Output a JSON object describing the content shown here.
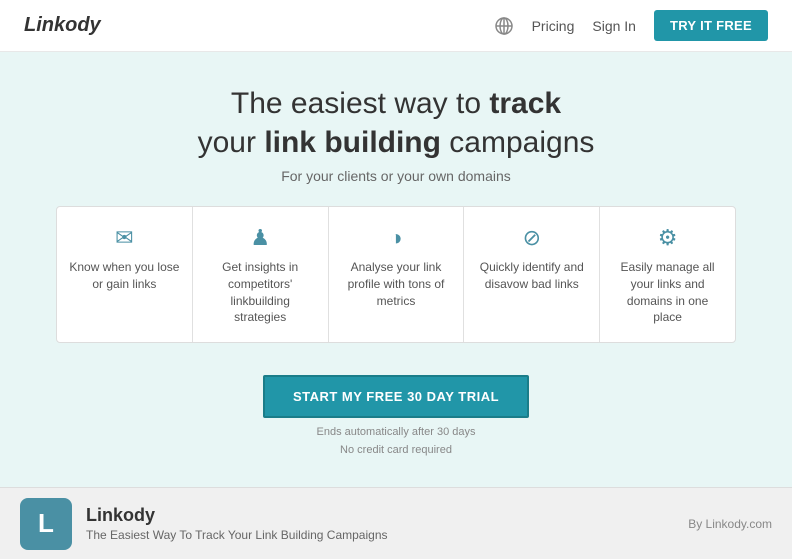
{
  "navbar": {
    "logo": "Linkody",
    "pricing_label": "Pricing",
    "signin_label": "Sign In",
    "try_label": "TRY IT FREE"
  },
  "hero": {
    "title_line1": "The easiest way to ",
    "title_bold1": "track",
    "title_line2": "your ",
    "title_bold2": "link building",
    "title_end": " campaigns",
    "subtitle": "For your clients or your own domains"
  },
  "features": [
    {
      "icon": "✉",
      "text": "Know when you lose or gain links"
    },
    {
      "icon": "♟",
      "text": "Get insights in competitors' linkbuilding strategies"
    },
    {
      "icon": "◑",
      "text": "Analyse your link profile with tons of metrics"
    },
    {
      "icon": "⊘",
      "text": "Quickly identify and disavow bad links"
    },
    {
      "icon": "⚙",
      "text": "Easily manage all your links and domains in one place"
    }
  ],
  "cta": {
    "button_label": "START MY FREE 30 DAY TRIAL",
    "note_line1": "Ends automatically after 30 days",
    "note_line2": "No credit card required"
  },
  "footer": {
    "logo_letter": "L",
    "app_name": "Linkody",
    "app_desc": "The Easiest Way To Track Your Link Building Campaigns",
    "by_text": "By Linkody.com"
  }
}
